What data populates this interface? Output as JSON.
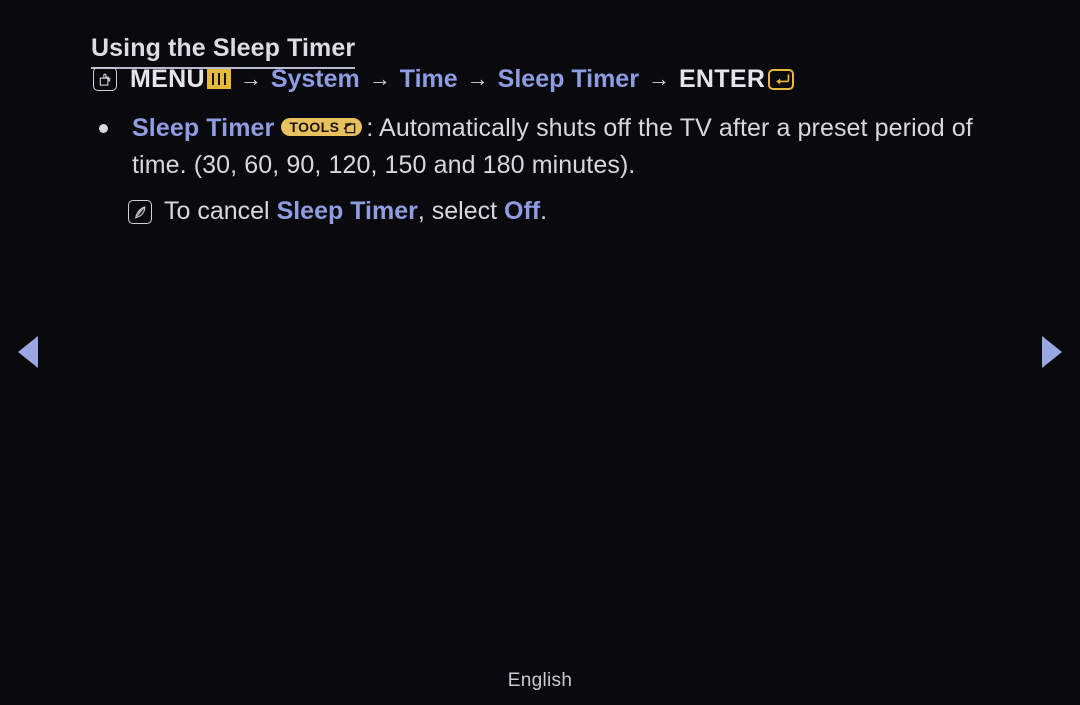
{
  "page": {
    "title": "Using the Sleep Timer",
    "background_color": "#0a0a0e",
    "text_color": "#d7d8de",
    "accent_blue": "#8e9ce2",
    "accent_gold": "#e5b93c"
  },
  "menu_path": {
    "press_icon": "hand-press-icon",
    "menu_label": "MENU",
    "menu_icon": "menu-bars-icon",
    "arrow_1": "→",
    "system_label": "System",
    "arrow_2": "→",
    "time_label": "Time",
    "arrow_3": "→",
    "sleep_timer_label": "Sleep Timer",
    "arrow_4": "→",
    "enter_label": "ENTER",
    "enter_icon": "enter-return-icon"
  },
  "bullet": {
    "marker": "bullet-dot",
    "feature_name": "Sleep Timer",
    "tools_badge_label": "TOOLS",
    "tools_badge_icon": "tools-arrow-icon",
    "description": ": Automatically shuts off the TV after a preset period of time. (30, 60, 90, 120, 150 and 180 minutes)."
  },
  "note": {
    "icon": "note-quill-icon",
    "prefix": "To cancel ",
    "term": "Sleep Timer",
    "middle": ", select ",
    "option": "Off",
    "suffix": "."
  },
  "navigation": {
    "prev_label": "previous-page",
    "next_label": "next-page"
  },
  "footer": {
    "language": "English"
  }
}
